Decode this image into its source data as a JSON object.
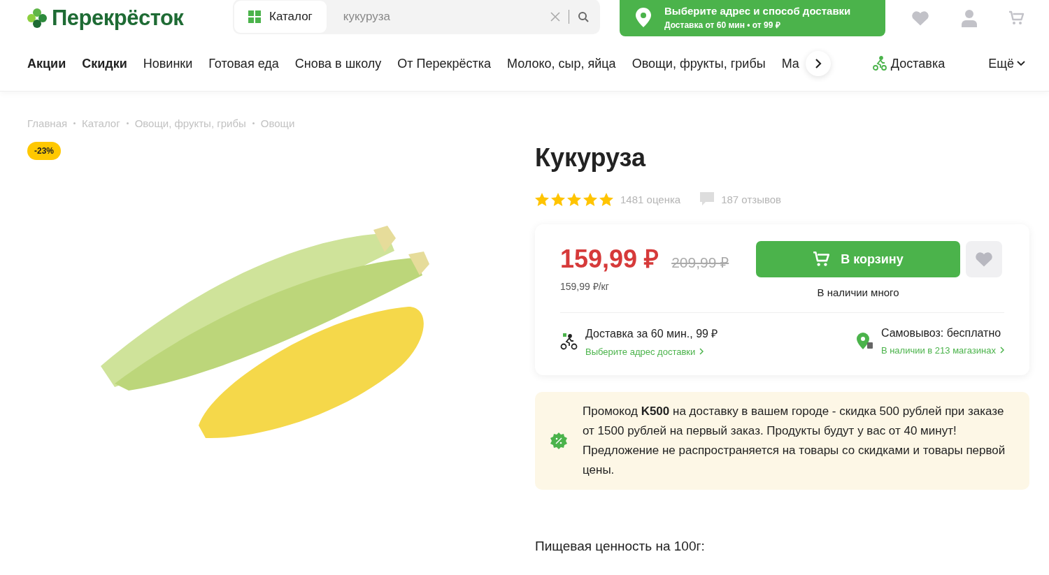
{
  "header": {
    "logo": "Перекрёсток",
    "catalog_button": "Каталог",
    "search": {
      "value": "кукуруза"
    },
    "delivery_button": {
      "title": "Выберите адрес и способ доставки",
      "subtitle": "Доставка от 60 мин • от 99 ₽"
    }
  },
  "nav": {
    "items": [
      {
        "label": "Акции",
        "emphasized": true
      },
      {
        "label": "Скидки",
        "emphasized": true
      },
      {
        "label": "Новинки",
        "emphasized": false
      },
      {
        "label": "Готовая еда",
        "emphasized": false
      },
      {
        "label": "Снова в школу",
        "emphasized": false
      },
      {
        "label": "От Перекрёстка",
        "emphasized": false
      },
      {
        "label": "Молоко, сыр, яйца",
        "emphasized": false
      },
      {
        "label": "Овощи, фрукты, грибы",
        "emphasized": false
      },
      {
        "label": "Ма",
        "emphasized": false
      }
    ],
    "delivery_link": "Доставка",
    "more": "Ещё"
  },
  "breadcrumbs": [
    "Главная",
    "Каталог",
    "Овощи, фрукты, грибы",
    "Овощи"
  ],
  "product": {
    "discount_badge": "-23%",
    "title": "Кукуруза",
    "stars": 5,
    "ratings": "1481 оценка",
    "reviews": "187 отзывов",
    "price": "159,99 ₽",
    "old_price": "209,99 ₽",
    "unit_price": "159,99 ₽/кг",
    "cart_button": "В корзину",
    "stock": "В наличии много",
    "delivery": {
      "title": "Доставка за 60 мин., 99 ₽",
      "link": "Выберите адрес доставки"
    },
    "pickup": {
      "title": "Самовывоз: бесплатно",
      "link": "В наличии в 213 магазинах"
    },
    "promo": "Промокод **K500** на доставку в вашем городе - скидка 500 рублей при заказе от 1500 рублей на первый заказ. Продукты будут у вас от 40 минут! Предложение не распространяется на товары со скидками и товары первой цены.",
    "nutrition_heading": "Пищевая ценность на 100г:"
  }
}
